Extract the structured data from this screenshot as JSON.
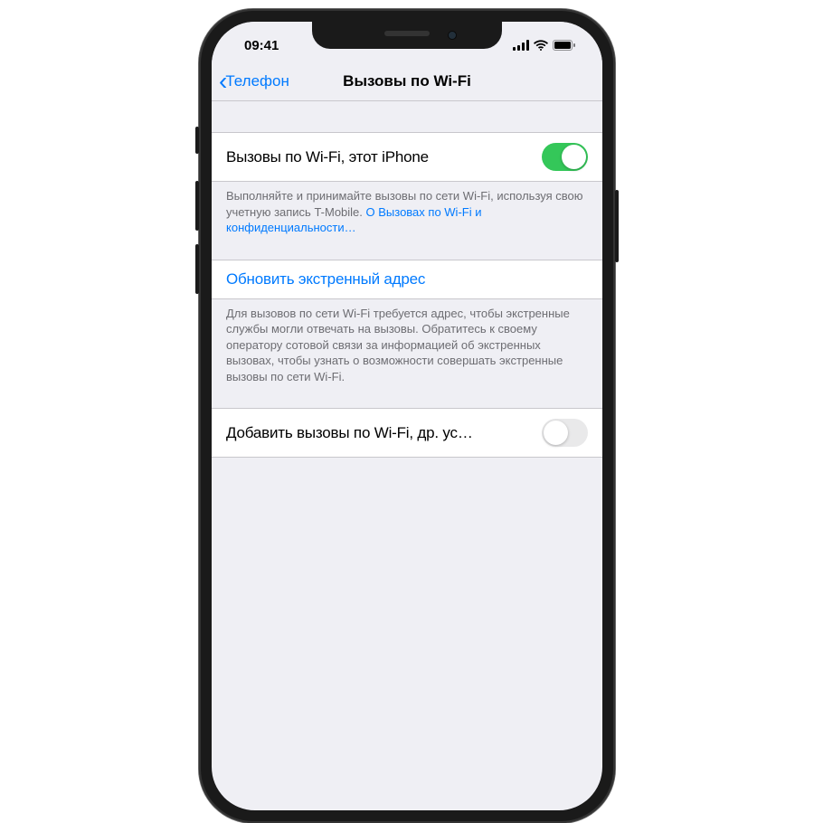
{
  "status": {
    "time": "09:41"
  },
  "nav": {
    "back": "Телефон",
    "title": "Вызовы по Wi-Fi"
  },
  "rows": {
    "wifi_this_iphone": {
      "label": "Вызовы по Wi-Fi, этот iPhone",
      "toggle_on": true
    },
    "wifi_footer": {
      "text": "Выполняйте и принимайте вызовы по сети Wi-Fi, используя свою учетную запись T-Mobile. ",
      "link": "О Вызовах по Wi-Fi и конфиденциальности…"
    },
    "update_address": {
      "label": "Обновить экстренный адрес"
    },
    "address_footer": {
      "text": "Для вызовов по сети Wi-Fi требуется адрес, чтобы экстренные службы могли отвечать на вызовы. Обратитесь к своему оператору сотовой связи за информацией об экстренных вызовах, чтобы узнать о возможности совершать экстренные вызовы по сети Wi-Fi."
    },
    "add_other_devices": {
      "label": "Добавить вызовы по Wi-Fi, др. ус…",
      "toggle_on": false
    }
  }
}
